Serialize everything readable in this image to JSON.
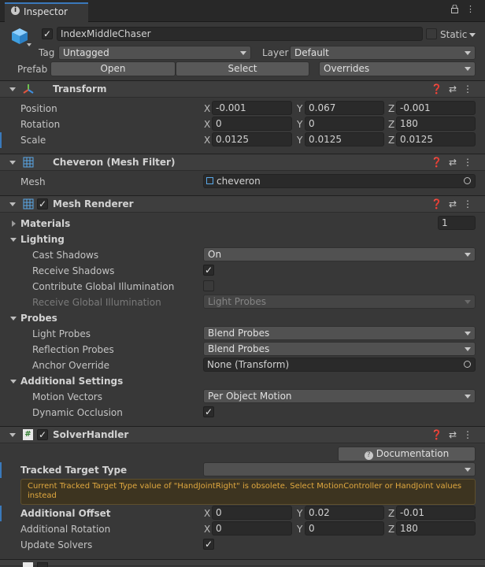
{
  "tab": {
    "title": "Inspector",
    "icon": "info-icon"
  },
  "object": {
    "name": "IndexMiddleChaser",
    "static_label": "Static",
    "tag_label": "Tag",
    "tag_value": "Untagged",
    "layer_label": "Layer",
    "layer_value": "Default",
    "prefab_label": "Prefab",
    "open_label": "Open",
    "select_label": "Select",
    "overrides_label": "Overrides"
  },
  "transform": {
    "title": "Transform",
    "position_label": "Position",
    "rotation_label": "Rotation",
    "scale_label": "Scale",
    "axes": [
      "X",
      "Y",
      "Z"
    ],
    "position": [
      "-0.001",
      "0.067",
      "-0.001"
    ],
    "rotation": [
      "0",
      "0",
      "180"
    ],
    "scale": [
      "0.0125",
      "0.0125",
      "0.0125"
    ]
  },
  "mesh_filter": {
    "title": "Cheveron (Mesh Filter)",
    "mesh_label": "Mesh",
    "mesh_value": "cheveron"
  },
  "mesh_renderer": {
    "title": "Mesh Renderer",
    "materials_label": "Materials",
    "materials_count": "1",
    "lighting_label": "Lighting",
    "cast_shadows_label": "Cast Shadows",
    "cast_shadows_value": "On",
    "receive_shadows_label": "Receive Shadows",
    "contribute_gi_label": "Contribute Global Illumination",
    "receive_gi_label": "Receive Global Illumination",
    "receive_gi_value": "Light Probes",
    "probes_label": "Probes",
    "light_probes_label": "Light Probes",
    "light_probes_value": "Blend Probes",
    "reflection_probes_label": "Reflection Probes",
    "reflection_probes_value": "Blend Probes",
    "anchor_override_label": "Anchor Override",
    "anchor_override_value": "None (Transform)",
    "additional_settings_label": "Additional Settings",
    "motion_vectors_label": "Motion Vectors",
    "motion_vectors_value": "Per Object Motion",
    "dynamic_occlusion_label": "Dynamic Occlusion"
  },
  "solver_handler": {
    "title": "SolverHandler",
    "documentation_label": "Documentation",
    "tracked_target_label": "Tracked Target Type",
    "tracked_target_value": "",
    "warning": "Current Tracked Target Type value of \"HandJointRight\" is obsolete. Select MotionController or HandJoint values instead",
    "additional_offset_label": "Additional Offset",
    "additional_offset": [
      "0",
      "0.02",
      "-0.01"
    ],
    "additional_rotation_label": "Additional Rotation",
    "additional_rotation": [
      "0",
      "0",
      "180"
    ],
    "update_solvers_label": "Update Solvers"
  },
  "colors": {
    "accent": "#3a79bb",
    "warning_text": "#e0a83f",
    "background": "#383838"
  }
}
